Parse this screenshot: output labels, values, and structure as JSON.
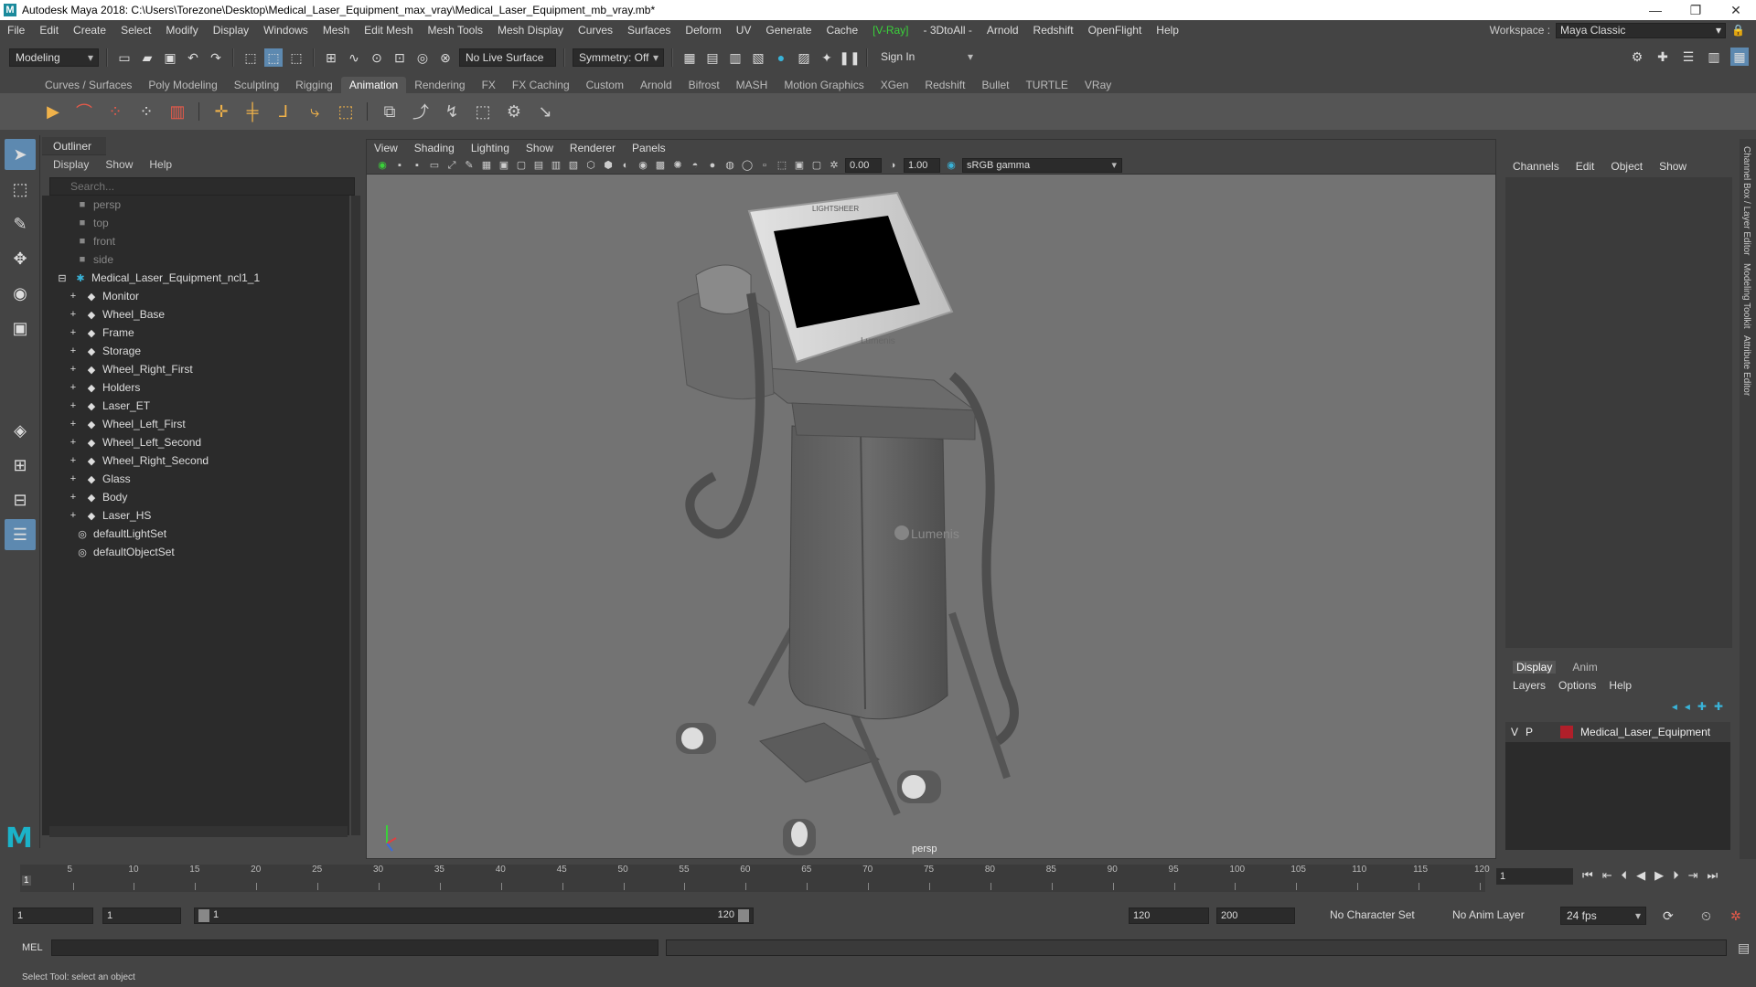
{
  "window": {
    "title": "Autodesk Maya 2018: C:\\Users\\Torezone\\Desktop\\Medical_Laser_Equipment_max_vray\\Medical_Laser_Equipment_mb_vray.mb*",
    "minimize": "—",
    "restore": "❐",
    "close": "✕"
  },
  "menubar": {
    "items": [
      "File",
      "Edit",
      "Create",
      "Select",
      "Modify",
      "Display",
      "Windows",
      "Mesh",
      "Edit Mesh",
      "Mesh Tools",
      "Mesh Display",
      "Curves",
      "Surfaces",
      "Deform",
      "UV",
      "Generate",
      "Cache",
      "[V-Ray]",
      "- 3DtoAll -",
      "Arnold",
      "Redshift",
      "OpenFlight",
      "Help"
    ],
    "workspace_label": "Workspace :",
    "workspace_value": "Maya Classic"
  },
  "statusline": {
    "mode": "Modeling",
    "live_surface": "No Live Surface",
    "symmetry": "Symmetry: Off",
    "sign_in": "Sign In"
  },
  "shelf": {
    "tabs": [
      "Curves / Surfaces",
      "Poly Modeling",
      "Sculpting",
      "Rigging",
      "Animation",
      "Rendering",
      "FX",
      "FX Caching",
      "Custom",
      "Arnold",
      "Bifrost",
      "MASH",
      "Motion Graphics",
      "XGen",
      "Redshift",
      "Bullet",
      "TURTLE",
      "VRay"
    ],
    "active_tab": "Animation"
  },
  "outliner": {
    "title": "Outliner",
    "menu": [
      "Display",
      "Show",
      "Help"
    ],
    "search_placeholder": "Search...",
    "cameras": [
      "persp",
      "top",
      "front",
      "side"
    ],
    "group": "Medical_Laser_Equipment_ncl1_1",
    "children": [
      "Monitor",
      "Wheel_Base",
      "Frame",
      "Storage",
      "Wheel_Right_First",
      "Holders",
      "Laser_ET",
      "Wheel_Left_First",
      "Wheel_Left_Second",
      "Wheel_Right_Second",
      "Glass",
      "Body",
      "Laser_HS"
    ],
    "sets": [
      "defaultLightSet",
      "defaultObjectSet"
    ]
  },
  "viewport": {
    "menu": [
      "View",
      "Shading",
      "Lighting",
      "Show",
      "Renderer",
      "Panels"
    ],
    "exposure": "0.00",
    "gamma": "1.00",
    "color_space": "sRGB gamma",
    "camera_label": "persp",
    "brand_top": "LIGHTSHEER",
    "brand_screen": "Lumenis",
    "brand_body": "Lumenis"
  },
  "channelbox": {
    "menu": [
      "Channels",
      "Edit",
      "Object",
      "Show"
    ],
    "layer_tabs": [
      "Display",
      "Anim"
    ],
    "layer_active": "Display",
    "layer_menu": [
      "Layers",
      "Options",
      "Help"
    ],
    "layer": {
      "v": "V",
      "p": "P",
      "name": "Medical_Laser_Equipment",
      "color": "#b01f2a"
    },
    "side_tabs": [
      "Channel Box / Layer Editor",
      "Modeling Toolkit",
      "Attribute Editor"
    ]
  },
  "timeline": {
    "ticks": [
      "5",
      "10",
      "15",
      "20",
      "25",
      "30",
      "35",
      "40",
      "45",
      "50",
      "55",
      "60",
      "65",
      "70",
      "75",
      "80",
      "85",
      "90",
      "95",
      "100",
      "105",
      "110",
      "115",
      "120"
    ],
    "current": "1",
    "current_field": "1"
  },
  "range": {
    "start": "1",
    "anim_start": "1",
    "slider_start": "1",
    "slider_end": "120",
    "end": "120",
    "anim_end": "200",
    "character_set": "No Character Set",
    "anim_layer": "No Anim Layer",
    "fps": "24 fps"
  },
  "cmdline": {
    "label": "MEL"
  },
  "helpline": {
    "text": "Select Tool: select an object"
  }
}
